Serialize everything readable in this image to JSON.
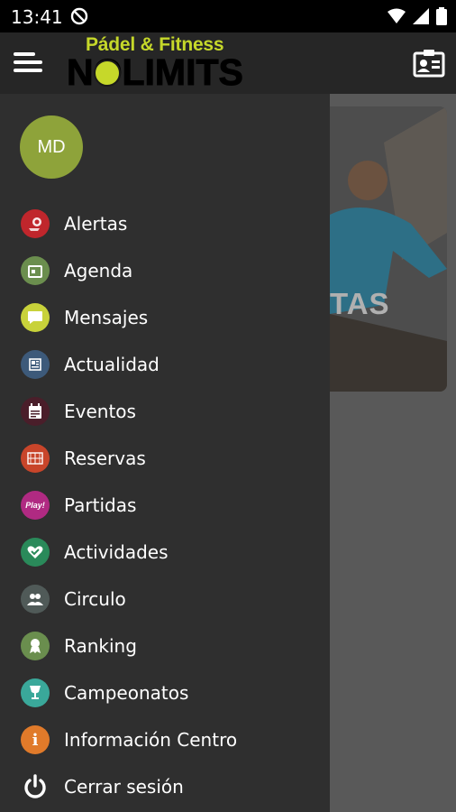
{
  "status_bar": {
    "time": "13:41"
  },
  "logo": {
    "tagline": "Pádel & Fitness",
    "brand": "NOLIMITS"
  },
  "user": {
    "initials": "MD"
  },
  "background_card": {
    "text": "TAS"
  },
  "menu": {
    "items": [
      {
        "label": "Alertas",
        "icon": "alert-bell-icon",
        "color": "#c0262c"
      },
      {
        "label": "Agenda",
        "icon": "calendar-icon",
        "color": "#6b8e4e"
      },
      {
        "label": "Mensajes",
        "icon": "chat-bubble-icon",
        "color": "#c8d23a"
      },
      {
        "label": "Actualidad",
        "icon": "news-icon",
        "color": "#3d5a7a"
      },
      {
        "label": "Eventos",
        "icon": "event-calendar-icon",
        "color": "#4a1e2a"
      },
      {
        "label": "Reservas",
        "icon": "court-icon",
        "color": "#c8452a"
      },
      {
        "label": "Partidas",
        "icon": "play-icon",
        "color": "#b02a82",
        "icon_text": "Play!"
      },
      {
        "label": "Actividades",
        "icon": "heart-check-icon",
        "color": "#2a8a5a"
      },
      {
        "label": "Circulo",
        "icon": "people-icon",
        "color": "#505a58"
      },
      {
        "label": "Ranking",
        "icon": "medal-icon",
        "color": "#6a8e4e"
      },
      {
        "label": "Campeonatos",
        "icon": "trophy-icon",
        "color": "#3aa89a"
      },
      {
        "label": "Información Centro",
        "icon": "info-icon",
        "color": "#e07a2a",
        "icon_text": "i"
      },
      {
        "label": "Cerrar sesión",
        "icon": "power-icon",
        "color": "#2f2f2f"
      }
    ]
  }
}
